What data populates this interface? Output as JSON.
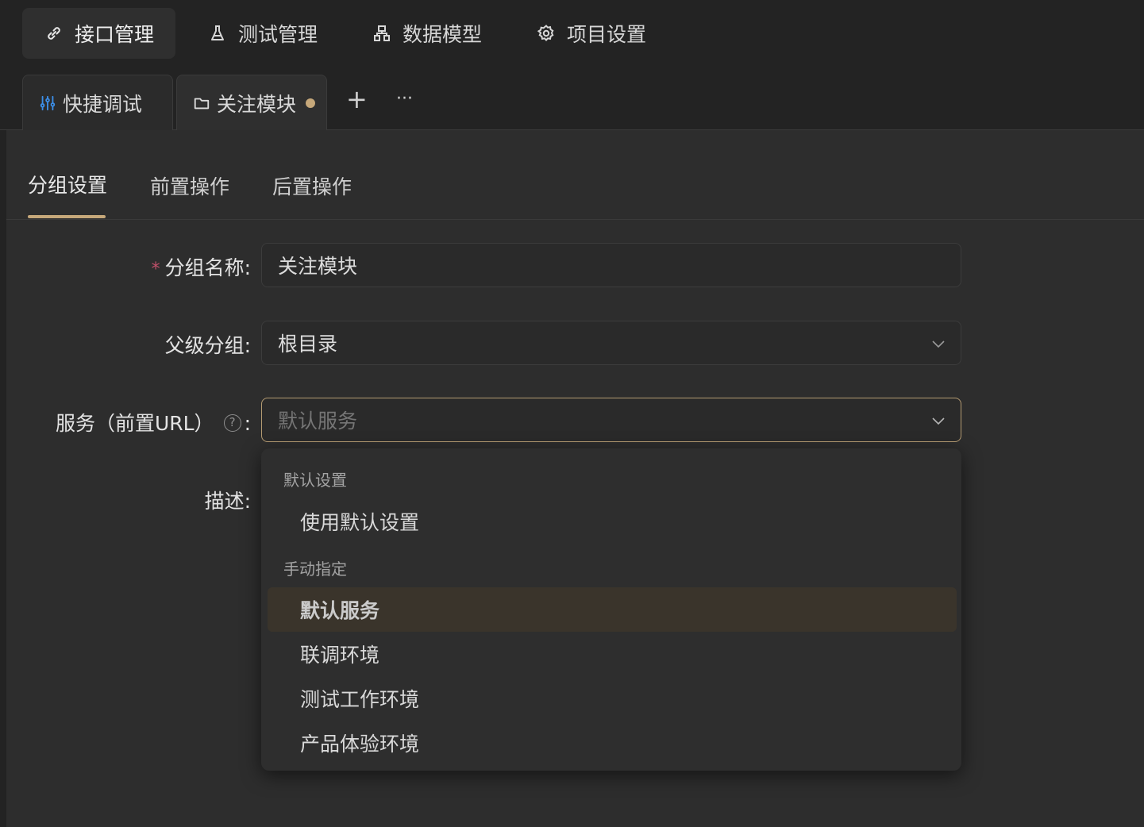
{
  "topnav": {
    "items": [
      {
        "label": "接口管理",
        "icon": "link-icon",
        "active": true
      },
      {
        "label": "测试管理",
        "icon": "flask-icon"
      },
      {
        "label": "数据模型",
        "icon": "model-icon"
      },
      {
        "label": "项目设置",
        "icon": "gear-icon"
      }
    ]
  },
  "tabs": {
    "items": [
      {
        "label": "快捷调试",
        "icon": "sliders-icon"
      },
      {
        "label": "关注模块",
        "icon": "folder-icon",
        "unsaved": true,
        "active": true
      }
    ],
    "add_label": "+",
    "more_label": "···"
  },
  "subtabs": [
    "分组设置",
    "前置操作",
    "后置操作"
  ],
  "form": {
    "name": {
      "required_mark": "*",
      "label": "分组名称:",
      "value": "关注模块"
    },
    "parent": {
      "label": "父级分组:",
      "value": "根目录"
    },
    "service": {
      "label": "服务（前置URL）",
      "help": "?",
      "colon": ":",
      "placeholder": "默认服务"
    },
    "desc": {
      "label": "描述:"
    }
  },
  "dropdown": {
    "group1_title": "默认设置",
    "group1_options": [
      "使用默认设置"
    ],
    "group2_title": "手动指定",
    "group2_options": [
      "默认服务",
      "联调环境",
      "测试工作环境",
      "产品体验环境"
    ],
    "selected": "默认服务"
  },
  "colors": {
    "accent": "#c6a87a",
    "required": "#c0506a",
    "background": "#232323",
    "panel": "#2d2d2d"
  }
}
